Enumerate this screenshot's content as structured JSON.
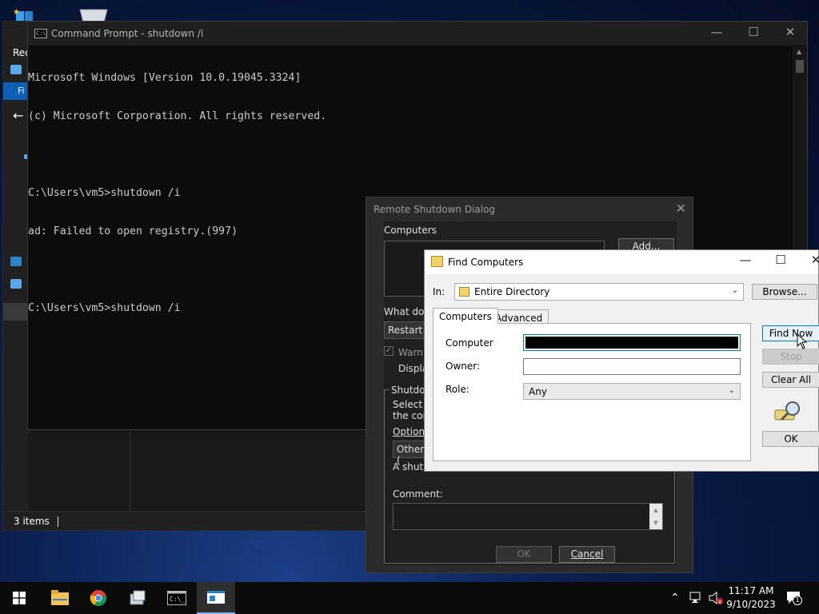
{
  "colors": {
    "accent": "#0c5fb5",
    "cmd_bg": "#0c0c0c",
    "dialog_dark": "#2b2b2b",
    "taskbar": "#0a0a0a"
  },
  "explorer": {
    "status_items": "3 items",
    "left_label": "Rec",
    "ribbon_file": "Fi"
  },
  "cmd": {
    "title": "Command Prompt - shutdown  /i",
    "lines": [
      "Microsoft Windows [Version 10.0.19045.3324]",
      "(c) Microsoft Corporation. All rights reserved.",
      "",
      "C:\\Users\\vm5>shutdown /i",
      "ad: Failed to open registry.(997)",
      "",
      "C:\\Users\\vm5>shutdown /i"
    ],
    "minimize": "—",
    "maximize": "☐",
    "close": "✕"
  },
  "remote_shutdown": {
    "title": "Remote Shutdown Dialog",
    "computers_label": "Computers",
    "add_button": "Add...",
    "what_do_label": "What do y",
    "action_value": "Restart",
    "warn_label": "Warn",
    "display_label": "Displa",
    "shutdown_group": "Shutdov",
    "select_text_1": "Select th",
    "select_text_2": "the com",
    "option_label": "Option",
    "option_value": "Other (",
    "shutdown_desc": "A shutd",
    "comment_label": "Comment:",
    "ok_button": "OK",
    "cancel_button": "Cancel",
    "close": "✕"
  },
  "find_computers": {
    "title": "Find Computers",
    "in_label": "In:",
    "in_value": "Entire Directory",
    "browse_button": "Browse...",
    "tabs": [
      {
        "label": "Computers"
      },
      {
        "label": "Advanced"
      }
    ],
    "computer_label": "Computer",
    "owner_label": "Owner:",
    "role_label": "Role:",
    "role_value": "Any",
    "buttons": {
      "find_now": "Find Now",
      "stop": "Stop",
      "clear_all": "Clear All",
      "ok": "OK"
    },
    "minimize": "—",
    "maximize": "☐",
    "close": "✕"
  },
  "taskbar": {
    "time": "11:17 AM",
    "date": "9/10/2023",
    "notification_count": "1"
  }
}
